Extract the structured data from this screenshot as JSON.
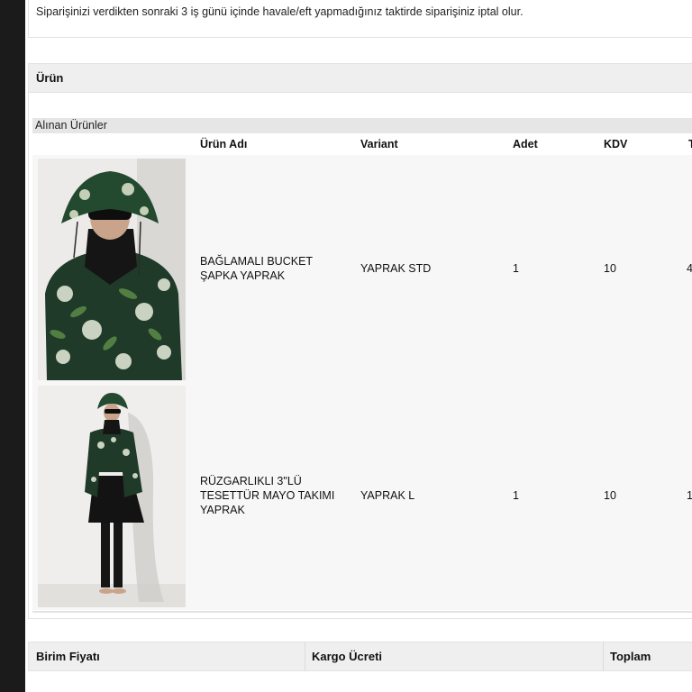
{
  "notice": {
    "text": "Siparişinizi verdikten sonraki 3 iş günü içinde havale/eft yapmadığınız taktirde siparişiniz iptal olur."
  },
  "section": {
    "title": "Ürün"
  },
  "items_table": {
    "caption": "Alınan Ürünler",
    "columns": [
      "Ürün Adı",
      "Variant",
      "Adet",
      "KDV",
      "T"
    ],
    "rows": [
      {
        "image": "product-photo-bucket-hat",
        "name": "BAĞLAMALI BUCKET ŞAPKA YAPRAK",
        "variant": "YAPRAK STD",
        "qty": "1",
        "kdv": "10",
        "total": "4"
      },
      {
        "image": "product-photo-swimsuit-set",
        "name": "RÜZGARLIKLI 3\"LÜ TESETTÜR MAYO TAKIMI YAPRAK",
        "variant": "YAPRAK L",
        "qty": "1",
        "kdv": "10",
        "total": "1"
      }
    ]
  },
  "totals": {
    "columns": [
      "Birim Fiyatı",
      "Kargo Ücreti",
      "Toplam"
    ]
  }
}
